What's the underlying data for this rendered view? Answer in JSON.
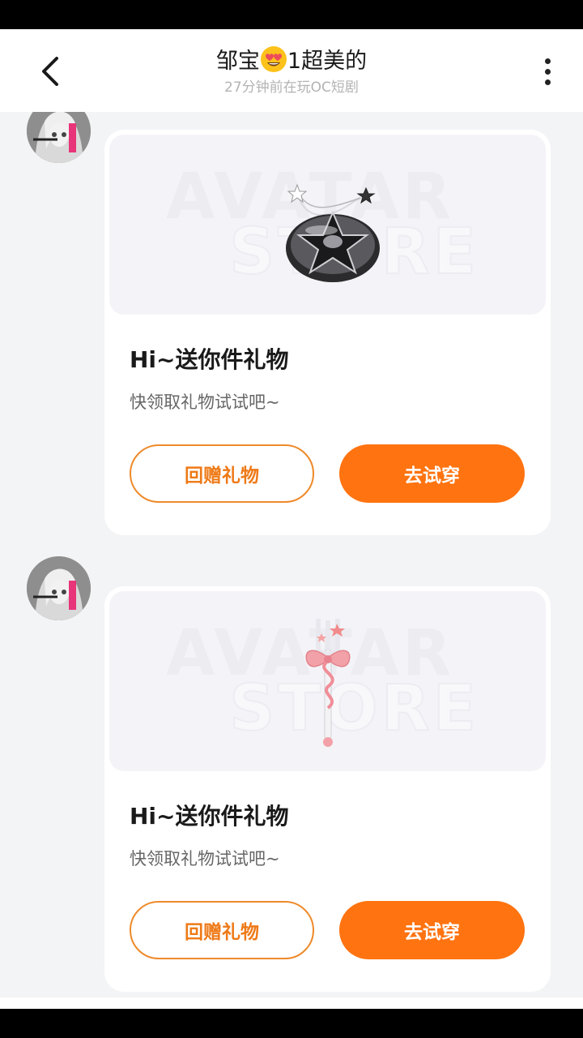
{
  "header": {
    "name_prefix": "邹宝",
    "emoji": "heart-eyes-emoji",
    "name_suffix": "1超美的",
    "subtitle": "27分钟前在玩OC短剧"
  },
  "messages": [
    {
      "gift_icon": "star-disc-hair-clip-icon",
      "watermark_line1": "AVATAR",
      "watermark_line2": "STORE",
      "title": "Hi~送你件礼物",
      "subtitle": "快领取礼物试试吧~",
      "return_label": "回赠礼物",
      "try_label": "去试穿"
    },
    {
      "gift_icon": "ribbon-fork-wand-icon",
      "watermark_line1": "AVATAR",
      "watermark_line2": "STORE",
      "title": "Hi~送你件礼物",
      "subtitle": "快领取礼物试试吧~",
      "return_label": "回赠礼物",
      "try_label": "去试穿"
    }
  ],
  "colors": {
    "accent": "#ff7310",
    "outline": "#ee8a2a",
    "chat_bg": "#f3f4f5"
  }
}
